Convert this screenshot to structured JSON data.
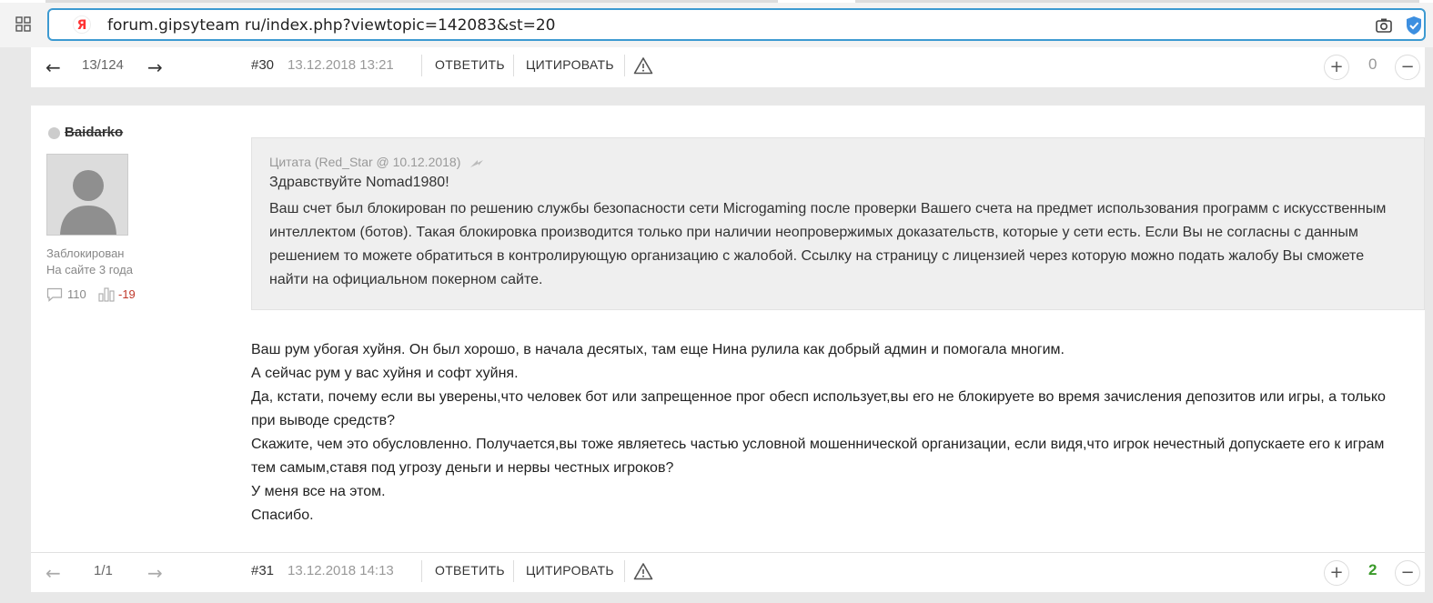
{
  "browser": {
    "url": "forum.gipsyteam ru/index.php?viewtopic=142083&st=20"
  },
  "posts": [
    {
      "nav": "13/124",
      "number": "#30",
      "date": "13.12.2018 13:21",
      "reply_label": "ОТВЕТИТЬ",
      "quote_label": "ЦИТИРОВАТЬ",
      "votes": "0"
    },
    {
      "nav": "1/1",
      "number": "#31",
      "date": "13.12.2018 14:13",
      "reply_label": "ОТВЕТИТЬ",
      "quote_label": "ЦИТИРОВАТЬ",
      "votes": "2"
    }
  ],
  "author": {
    "name": "Baidarko",
    "status": "Заблокирован",
    "since": "На сайте 3 года",
    "posts_count": "110",
    "rating": "-19"
  },
  "quote": {
    "header": "Цитата (Red_Star @ 10.12.2018)",
    "greeting": "Здравствуйте Nomad1980!",
    "text": "Ваш счет был блокирован по решению службы безопасности сети Microgaming после проверки Вашего счета на предмет использования программ с искусственным интеллектом (ботов). Такая блокировка производится только при наличии неопровержимых доказательств, которые у сети есть. Если Вы не согласны с данным решением то можете обратиться в контролирующую организацию с жалобой. Ссылку на страницу с лицензией через которую можно подать жалобу Вы сможете найти на официальном покерном сайте."
  },
  "message": {
    "lines": [
      "Ваш рум убогая хуйня. Он был хорошо, в начала десятых, там еще Нина рулила как добрый админ и помогала многим.",
      "А сейчас рум у вас хуйня и софт хуйня.",
      "Да, кстати, почему если вы уверены,что человек бот или запрещенное прог обесп использует,вы его не блокируете во время зачисления депозитов или игры, а только при выводе средств?",
      "Скажите, чем это обусловленно. Получается,вы тоже являетесь частью условной мошеннической организации, если видя,что игрок нечестный допускаете его к играм тем самым,ставя под угрозу деньги и нервы честных игроков?",
      "У меня все на этом.",
      "Спасибо."
    ]
  },
  "colors": {
    "accent_border": "#3d9ad1",
    "rating_negative": "#c0392b",
    "votes_positive": "#3a9a2a"
  },
  "icons": [
    "grid-icon",
    "yandex-icon",
    "camera-icon",
    "shield-check-icon",
    "arrow-left-icon",
    "arrow-right-icon",
    "warning-icon",
    "plus-icon",
    "minus-icon",
    "comment-icon",
    "rating-icon",
    "quote-link-icon",
    "avatar-silhouette"
  ]
}
